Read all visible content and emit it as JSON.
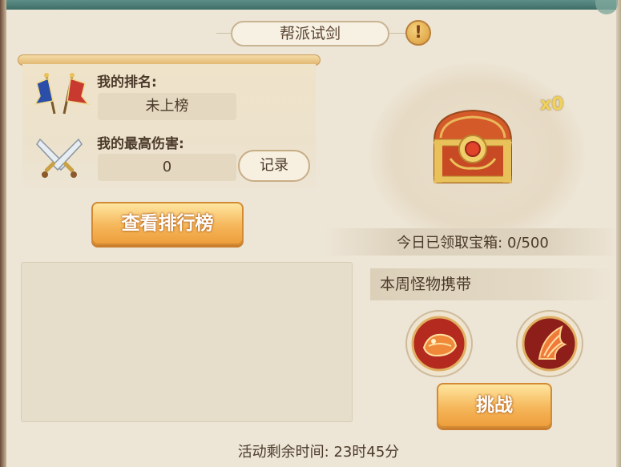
{
  "title": "帮派试剑",
  "info_icon": "exclamation-icon",
  "my_rank": {
    "label": "我的排名:",
    "value": "未上榜",
    "icon": "banner-flags-icon"
  },
  "max_damage": {
    "label": "我的最高伤害:",
    "value": "0",
    "icon": "crossed-swords-icon"
  },
  "record_button": "记录",
  "ranking_button": "查看排行榜",
  "chest": {
    "count": "x0",
    "icon": "treasure-chest-icon",
    "claimed_text": "今日已领取宝箱: 0/500"
  },
  "monsters": {
    "header": "本周怪物携带",
    "icons": [
      "fish-monster-icon",
      "wing-monster-icon"
    ]
  },
  "challenge_button": "挑战",
  "timer_text": "活动剩余时间: 23时45分",
  "colors": {
    "accent_orange": "#f5b75b",
    "panel_bg": "#ede5d6",
    "chest_gold": "#f1d15a"
  }
}
